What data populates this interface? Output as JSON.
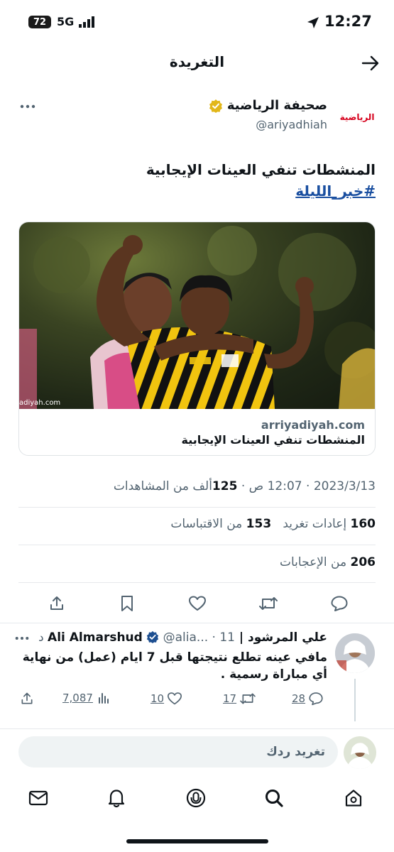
{
  "status_bar": {
    "battery": "72",
    "network": "5G",
    "time": "12:27"
  },
  "header": {
    "title": "التغريدة"
  },
  "tweet": {
    "author_name": "صحيفة الرياضية",
    "author_handle": "@ariyadhiah",
    "avatar_logo_text": "الرياضية",
    "text_line1": "المنشطات تنفي العينات الإيجابية",
    "hashtag": "#خبر_الليلة",
    "card": {
      "image_watermark": "adiyah.com",
      "domain": "arriyadiyah.com",
      "title": "المنشطات تنفي العينات الإيجابية"
    },
    "meta": {
      "date": "2023/3/13",
      "time": "12:07 ص",
      "views_count": "125",
      "views_label": "ألف من المشاهدات"
    },
    "stats": {
      "retweets_count": "160",
      "retweets_label": "إعادات تغريد",
      "quotes_count": "153",
      "quotes_label": "من الاقتباسات",
      "likes_count": "206",
      "likes_label": "من الإعجابات"
    }
  },
  "reply": {
    "author_name": "علي المرشود | Ali Almarshud",
    "author_handle": "@alia...",
    "time_ago": "11 د",
    "text_line1": "مافي عينه تطلع نتيجتها قبل 7 ايام (عمل) من نهاية",
    "text_line2": "أي مباراة رسمية .",
    "replies": "28",
    "retweets": "17",
    "likes": "10",
    "views": "7,087"
  },
  "compose": {
    "placeholder": "تغريد ردك"
  },
  "colors": {
    "accent": "#1d9bf0",
    "text": "#0f1419",
    "secondary": "#536471",
    "verified_gold": "#e2b719",
    "link": "#1a4fa0"
  },
  "icons": {
    "back": "arrow-right-icon",
    "more": "more-icon",
    "verified": "verified-badge-icon",
    "reply": "reply-icon",
    "retweet": "retweet-icon",
    "like": "heart-icon",
    "bookmark": "bookmark-icon",
    "share": "share-icon",
    "views": "views-icon",
    "home": "home-icon",
    "search": "search-icon",
    "spaces": "spaces-icon",
    "notifications": "bell-icon",
    "messages": "mail-icon"
  }
}
